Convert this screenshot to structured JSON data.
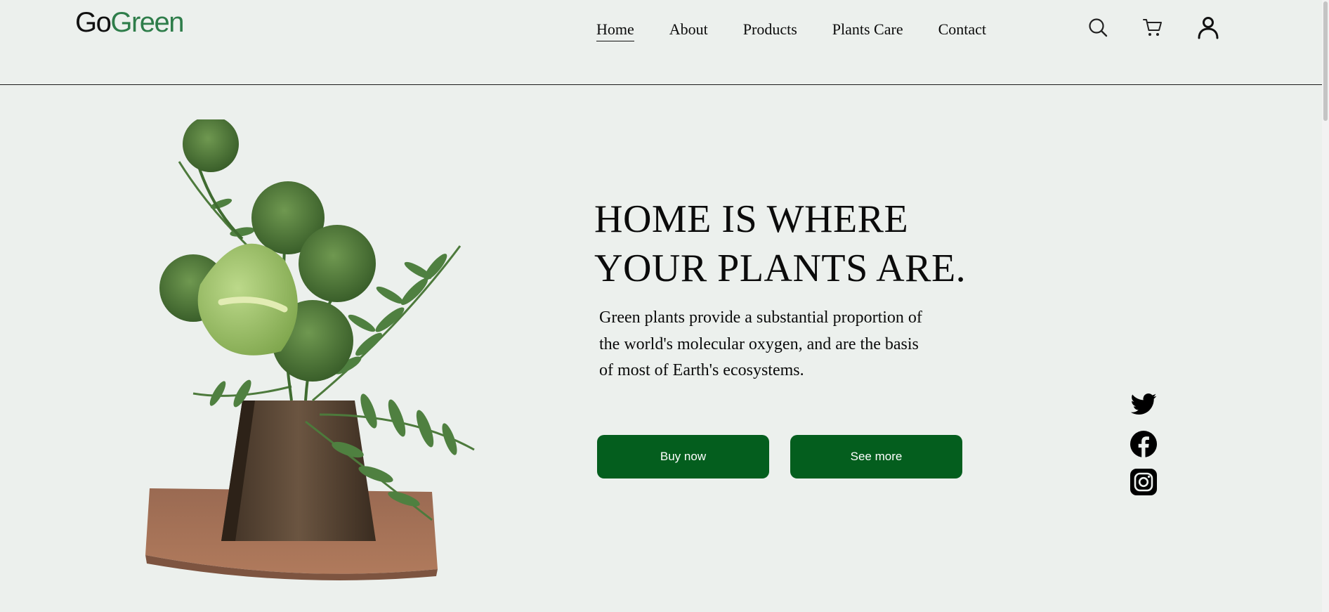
{
  "header": {
    "logo": {
      "part1": "Go",
      "part2": "Green"
    },
    "nav": [
      {
        "label": "Home",
        "active": true
      },
      {
        "label": "About",
        "active": false
      },
      {
        "label": "Products",
        "active": false
      },
      {
        "label": "Plants Care",
        "active": false
      },
      {
        "label": "Contact",
        "active": false
      }
    ],
    "icons": [
      "search-icon",
      "cart-icon",
      "user-icon"
    ]
  },
  "hero": {
    "headline_line1": "HOME IS WHERE",
    "headline_line2": "YOUR PLANTS ARE.",
    "description": "Green plants provide a substantial proportion of the world's molecular oxygen, and are the basis of most of Earth's ecosystems.",
    "buttons": {
      "buy": "Buy now",
      "see": "See more"
    },
    "image_icon": "plant-vase-image"
  },
  "social": [
    "twitter-icon",
    "facebook-icon",
    "instagram-icon"
  ],
  "colors": {
    "background": "#ecf0ed",
    "brand_green": "#2e7d4a",
    "button_green": "#045e1e",
    "text": "#0b0b0b"
  }
}
